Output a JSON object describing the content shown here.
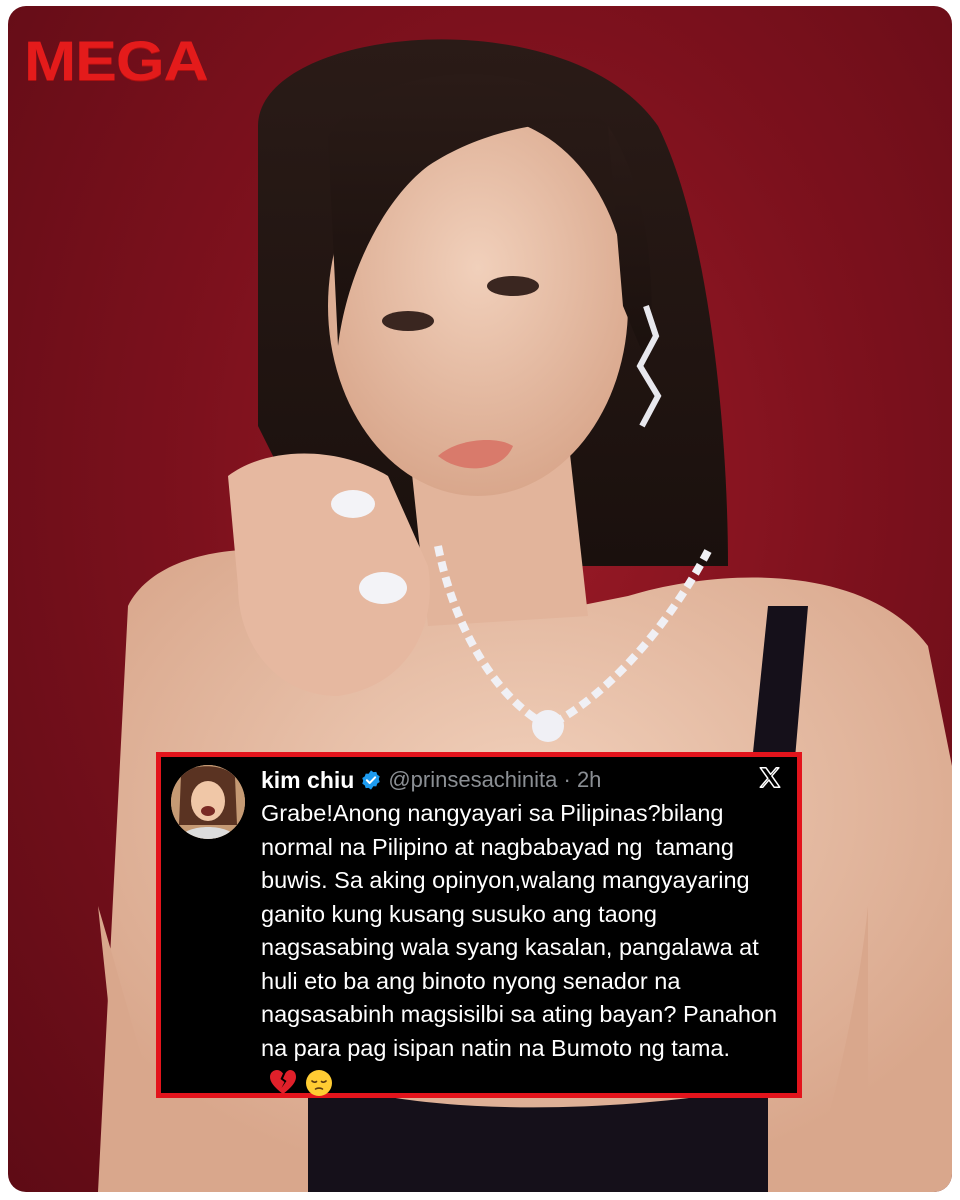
{
  "brand": {
    "logo_text": "MEGA",
    "color": "#e41b1b"
  },
  "background": {
    "color": "#7d111d"
  },
  "tweet": {
    "display_name": "kim chiu",
    "verified": true,
    "handle_time": "@prinsesachinita · 2h",
    "platform_icon": "x-logo-icon",
    "text": "Grabe!Anong nangyayari sa Pilipinas?bilang normal na Pilipino at nagbabayad ng  tamang buwis. Sa aking opinyon,walang mangyayaring ganito kung kusang susuko ang taong nagsasabing wala syang kasalan, pangalawa at huli eto ba ang binoto nyong senador na nagsasabinh magsisilbi sa ating bayan? Panahon na para pag isipan natin na Bumoto ng tama.",
    "emojis": [
      "broken-heart-icon",
      "pensive-face-icon"
    ],
    "border_color": "#e3141c"
  }
}
